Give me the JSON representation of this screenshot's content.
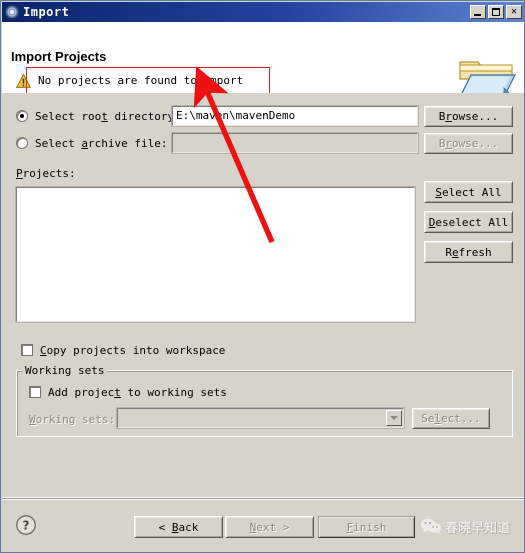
{
  "window": {
    "title": "Import",
    "icon": "import-wizard-icon",
    "controls": {
      "minimize": "–",
      "maximize": "□",
      "close": "✕"
    }
  },
  "header": {
    "title": "Import Projects",
    "message": "No projects are found to import",
    "message_icon": "warning-icon",
    "decor_icon": "open-folder-icon",
    "annotation_box_color": "#cc2222"
  },
  "form": {
    "root_dir": {
      "label_pre": "Select roo",
      "label_mnemonic": "t",
      "label_post": " directory:",
      "checked": true,
      "value": "E:\\maven\\mavenDemo",
      "browse_label_pre": "B",
      "browse_mnemonic": "r",
      "browse_label_post": "owse..."
    },
    "archive_file": {
      "label_pre": "Select ",
      "label_mnemonic": "a",
      "label_post": "rchive file:",
      "checked": false,
      "value": "",
      "browse_label_pre": "B",
      "browse_mnemonic": "r",
      "browse_label_post": "owse..."
    },
    "projects_label_mnemonic": "P",
    "projects_label_post": "rojects:",
    "projects_items": [],
    "side_buttons": [
      {
        "pre": "",
        "mnemonic": "S",
        "post": "elect All",
        "name": "select-all-button",
        "disabled": false
      },
      {
        "pre": "",
        "mnemonic": "D",
        "post": "eselect All",
        "name": "deselect-all-button",
        "disabled": false
      },
      {
        "pre": "R",
        "mnemonic": "e",
        "post": "fresh",
        "name": "refresh-button",
        "disabled": false
      }
    ],
    "copy_projects": {
      "label_mnemonic": "C",
      "label_post": "opy projects into workspace",
      "checked": false
    }
  },
  "working_sets": {
    "group_label": "Working sets",
    "add_project": {
      "label_pre": "Add projec",
      "label_mnemonic": "t",
      "label_post": " to working sets",
      "checked": false
    },
    "combo_label_mnemonic": "W",
    "combo_label_post": "orking sets:",
    "combo_value": "",
    "select_label_pre": "Se",
    "select_label_mnemonic": "l",
    "select_label_post": "ect...",
    "disabled": true
  },
  "footer": {
    "help_icon": "help-icon",
    "back_pre": "< ",
    "back_mnemonic": "B",
    "back_post": "ack",
    "back_disabled": false,
    "next_mnemonic": "N",
    "next_post": "ext >",
    "next_disabled": true,
    "finish_pre": "",
    "finish_mnemonic": "F",
    "finish_post": "inish",
    "finish_disabled": true,
    "watermark_text": "春晓早知道",
    "watermark_icon": "wechat-icon"
  }
}
